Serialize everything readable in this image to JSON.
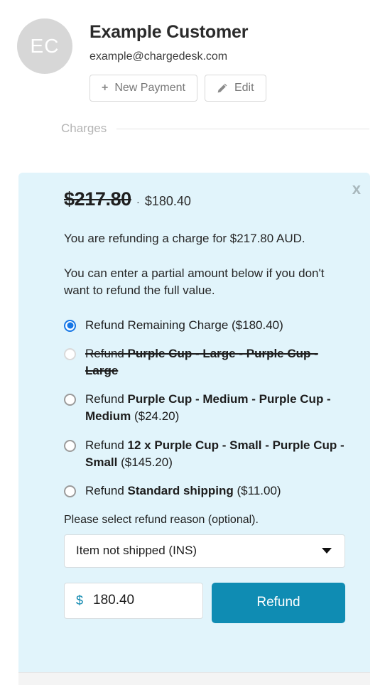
{
  "customer": {
    "avatar_initials": "EC",
    "name": "Example Customer",
    "email": "example@chargedesk.com",
    "actions": {
      "new_payment_label": "New Payment",
      "new_payment_icon": "plus-icon",
      "edit_label": "Edit",
      "edit_icon": "pencil-icon"
    }
  },
  "sections": {
    "charges_label": "Charges"
  },
  "refund_panel": {
    "close_label": "x",
    "original_amount": "$217.80",
    "separator": "·",
    "remaining_amount": "$180.40",
    "intro_text": "You are refunding a charge for $217.80 AUD.",
    "partial_text": "You can enter a partial amount below if you don't want to refund the full value.",
    "options": [
      {
        "prefix": "Refund ",
        "item": "Remaining Charge",
        "item_bold": false,
        "amount": " ($180.40)",
        "selected": true,
        "struck": false
      },
      {
        "prefix": "Refund ",
        "item": "Purple Cup - Large - Purple Cup - Large",
        "item_bold": true,
        "amount": "",
        "selected": false,
        "struck": true
      },
      {
        "prefix": "Refund ",
        "item": "Purple Cup - Medium - Purple Cup - Medium",
        "item_bold": true,
        "amount": " ($24.20)",
        "selected": false,
        "struck": false
      },
      {
        "prefix": "Refund ",
        "item": "12 x Purple Cup - Small - Purple Cup - Small",
        "item_bold": true,
        "amount": " ($145.20)",
        "selected": false,
        "struck": false
      },
      {
        "prefix": "Refund ",
        "item": "Standard shipping",
        "item_bold": true,
        "amount": " ($11.00)",
        "selected": false,
        "struck": false
      }
    ],
    "reason_label": "Please select refund reason (optional).",
    "reason_selected": "Item not shipped (INS)",
    "currency_symbol": "$",
    "amount_value": "180.40",
    "refund_button_label": "Refund"
  },
  "colors": {
    "panel_background": "#e1f4fb",
    "refund_button": "#0f8cb3",
    "radio_selected": "#1677e6",
    "currency_accent": "#1189b0",
    "avatar_background": "#d7d7d7"
  }
}
